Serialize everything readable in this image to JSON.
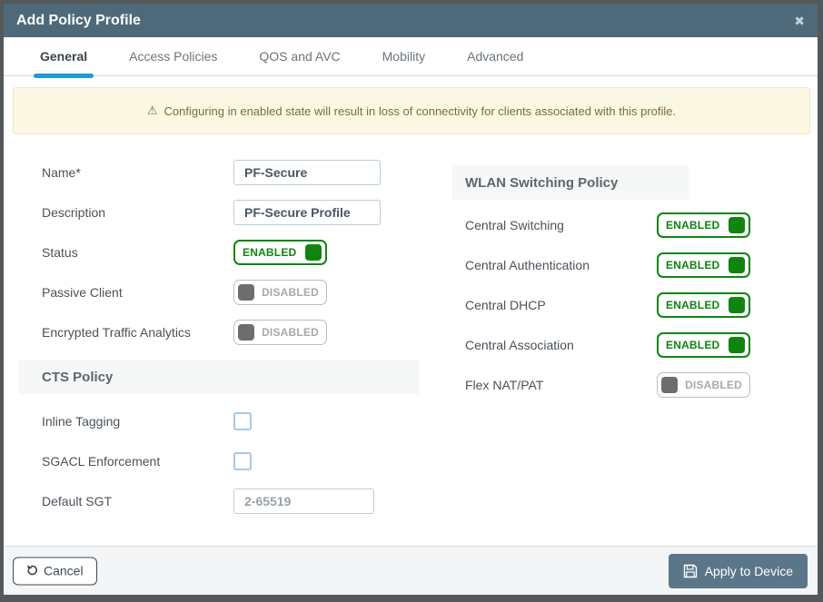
{
  "dialog": {
    "title": "Add Policy Profile",
    "close_icon": "✖"
  },
  "tabs": [
    {
      "label": "General",
      "active": true
    },
    {
      "label": "Access Policies",
      "active": false
    },
    {
      "label": "QOS and AVC",
      "active": false
    },
    {
      "label": "Mobility",
      "active": false
    },
    {
      "label": "Advanced",
      "active": false
    }
  ],
  "warning": {
    "icon": "⚠",
    "text": "Configuring in enabled state will result in loss of connectivity for clients associated with this profile."
  },
  "general_form": {
    "name_label": "Name*",
    "name_value": "PF-Secure",
    "description_label": "Description",
    "description_value": "PF-Secure Profile",
    "status_label": "Status",
    "status_value": "ENABLED",
    "passive_client_label": "Passive Client",
    "passive_client_value": "DISABLED",
    "eta_label": "Encrypted Traffic Analytics",
    "eta_value": "DISABLED"
  },
  "cts_policy": {
    "title": "CTS Policy",
    "inline_tagging_label": "Inline Tagging",
    "sgacl_label": "SGACL Enforcement",
    "default_sgt_label": "Default SGT",
    "default_sgt_placeholder": "2-65519"
  },
  "wlan_switching": {
    "title": "WLAN Switching Policy",
    "rows": [
      {
        "label": "Central Switching",
        "value": "ENABLED"
      },
      {
        "label": "Central Authentication",
        "value": "ENABLED"
      },
      {
        "label": "Central DHCP",
        "value": "ENABLED"
      },
      {
        "label": "Central Association",
        "value": "ENABLED"
      },
      {
        "label": "Flex NAT/PAT",
        "value": "DISABLED"
      }
    ]
  },
  "footer": {
    "cancel_label": "Cancel",
    "apply_label": "Apply to Device"
  },
  "colors": {
    "header_bg": "#4e6a7a",
    "tab_accent": "#1f9ad6",
    "enabled_green": "#0f8510",
    "disabled_gray": "#6d6d6d",
    "warning_bg": "#fcf7e2",
    "warning_text": "#7d6c3e",
    "apply_button_bg": "#5b7689"
  }
}
